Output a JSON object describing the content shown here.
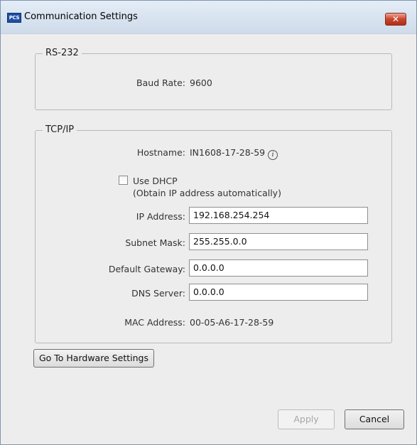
{
  "window": {
    "title": "Communication Settings",
    "app_icon_text": "PCS",
    "close_glyph": "✕"
  },
  "rs232": {
    "legend": "RS-232",
    "baud_label": "Baud Rate:",
    "baud_value": "9600"
  },
  "tcpip": {
    "legend": "TCP/IP",
    "hostname_label": "Hostname:",
    "hostname_value": "IN1608-17-28-59",
    "use_dhcp_label": "Use DHCP",
    "use_dhcp_sub": "(Obtain IP address automatically)",
    "use_dhcp_checked": false,
    "ip_label": "IP Address:",
    "ip_value": "192.168.254.254",
    "subnet_label": "Subnet Mask:",
    "subnet_value": "255.255.0.0",
    "gateway_label": "Default Gateway:",
    "gateway_value": "0.0.0.0",
    "dns_label": "DNS Server:",
    "dns_value": "0.0.0.0",
    "mac_label": "MAC Address:",
    "mac_value": "00-05-A6-17-28-59"
  },
  "buttons": {
    "hardware": "Go To Hardware Settings",
    "apply": "Apply",
    "cancel": "Cancel"
  },
  "colors": {
    "titlebar": "#cfdbea",
    "window_bg": "#eeedee",
    "close_button": "#c9442c",
    "app_icon": "#1f4fa6"
  }
}
